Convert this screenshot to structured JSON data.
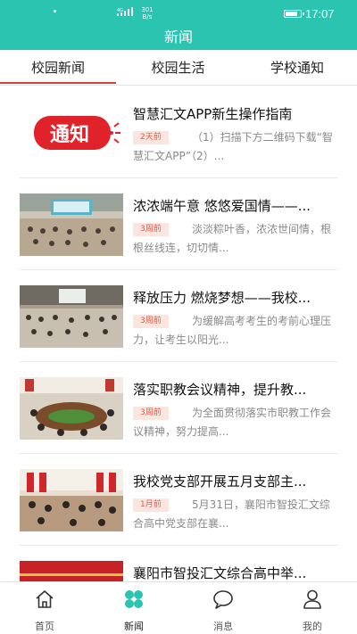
{
  "status_bar": {
    "network_speed_value": "301",
    "network_speed_unit": "B/s",
    "time": "17:07",
    "battery_level": 0.8
  },
  "header": {
    "title": "新闻"
  },
  "tabs": [
    {
      "label": "校园新闻",
      "active": true
    },
    {
      "label": "校园生活",
      "active": false
    },
    {
      "label": "学校通知",
      "active": false
    }
  ],
  "news": [
    {
      "title": "智慧汇文APP新生操作指南",
      "time_badge": "2天前",
      "summary": "（1）扫描下方二维码下载“智慧汇文APP”（2）...",
      "thumb_text": "通知"
    },
    {
      "title": "浓浓端午意 悠悠爱国情——...",
      "time_badge": "3周前",
      "summary": "淡淡粽叶香，浓浓世间情，根根丝线连，切切情..."
    },
    {
      "title": "释放压力 燃烧梦想——我校...",
      "time_badge": "3周前",
      "summary": "为缓解高考考生的考前心理压力，让考生以阳光..."
    },
    {
      "title": "落实职教会议精神，提升教...",
      "time_badge": "3周前",
      "summary": "为全面贯彻落实市职教工作会议精神，努力提高..."
    },
    {
      "title": "我校党支部开展五月支部主...",
      "time_badge": "1月前",
      "summary": "5月31日，襄阳市智投汇文综合高中党支部在襄..."
    },
    {
      "title": "襄阳市智投汇文综合高中举...",
      "time_badge": "",
      "summary": ""
    }
  ],
  "bottom_nav": [
    {
      "label": "首页",
      "icon": "home-icon",
      "active": false
    },
    {
      "label": "新闻",
      "icon": "news-clover-icon",
      "active": true
    },
    {
      "label": "消息",
      "icon": "message-icon",
      "active": false
    },
    {
      "label": "我的",
      "icon": "profile-icon",
      "active": false
    }
  ],
  "colors": {
    "header": "#2bc4b1",
    "tab_active_underline": "#d9403d",
    "badge_text": "#e05a4a",
    "badge_bg": "#fbe5df",
    "nav_active": "#2bc4b1"
  }
}
